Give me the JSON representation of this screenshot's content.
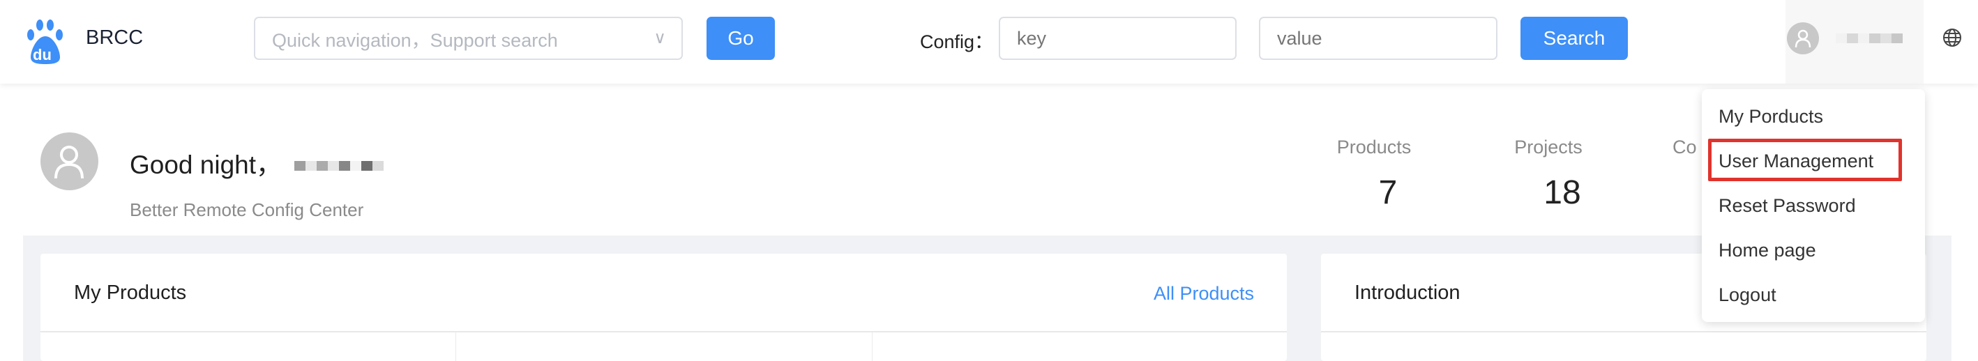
{
  "header": {
    "app_name": "BRCC",
    "logo_text": "du",
    "quick_nav_placeholder": "Quick navigation，Support search",
    "go_label": "Go",
    "config_label": "Config：",
    "key_placeholder": "key",
    "value_placeholder": "value",
    "search_label": "Search",
    "icons": {
      "user": "user-icon",
      "language": "globe-icon",
      "dropdown": "chevron-down-icon"
    }
  },
  "welcome": {
    "greeting": "Good night，",
    "subtitle": "Better Remote Config Center"
  },
  "stats": [
    {
      "label": "Products",
      "value": "7"
    },
    {
      "label": "Projects",
      "value": "18"
    },
    {
      "label": "Co"
    }
  ],
  "cards": {
    "products_title": "My Products",
    "all_products_link": "All Products",
    "intro_title": "Introduction"
  },
  "user_menu": {
    "items": [
      "My Porducts",
      "User Management",
      "Reset Password",
      "Home page",
      "Logout"
    ],
    "highlighted": "User Management",
    "highlight_color": "#e0332d"
  },
  "colors": {
    "primary": "#3e8ff7",
    "background": "#f0f2f5"
  }
}
